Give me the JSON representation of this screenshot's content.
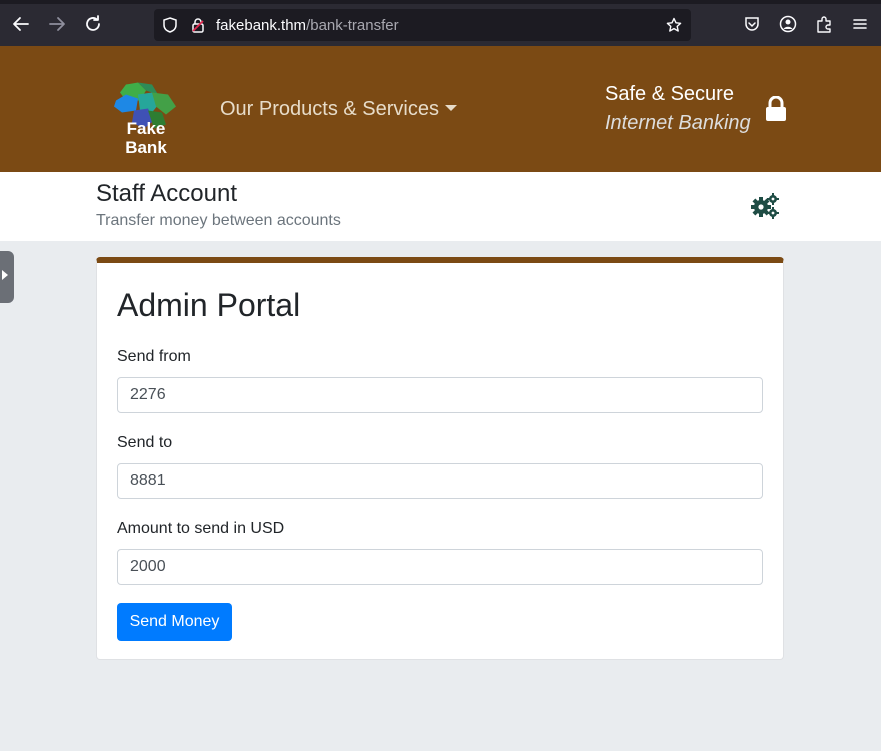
{
  "browser": {
    "url_host": "fakebank.thm",
    "url_path": "/bank-transfer",
    "icons": [
      "back-icon",
      "forward-icon",
      "reload-icon",
      "shield-icon",
      "lock-warning-icon",
      "star-icon",
      "pocket-icon",
      "account-icon",
      "extensions-icon",
      "menu-icon"
    ]
  },
  "header": {
    "logo_line1": "Fake",
    "logo_line2": "Bank",
    "products_label": "Our Products & Services",
    "safe_line1": "Safe & Secure",
    "safe_line2": "Internet Banking",
    "brand_color": "#7b4a14"
  },
  "staff": {
    "title": "Staff Account",
    "subtitle": "Transfer money between accounts"
  },
  "portal": {
    "title": "Admin Portal",
    "send_from_label": "Send from",
    "send_from_value": "2276",
    "send_to_label": "Send to",
    "send_to_value": "8881",
    "amount_label": "Amount to send in USD",
    "amount_value": "2000",
    "button_label": "Send Money",
    "button_color": "#007bff"
  }
}
